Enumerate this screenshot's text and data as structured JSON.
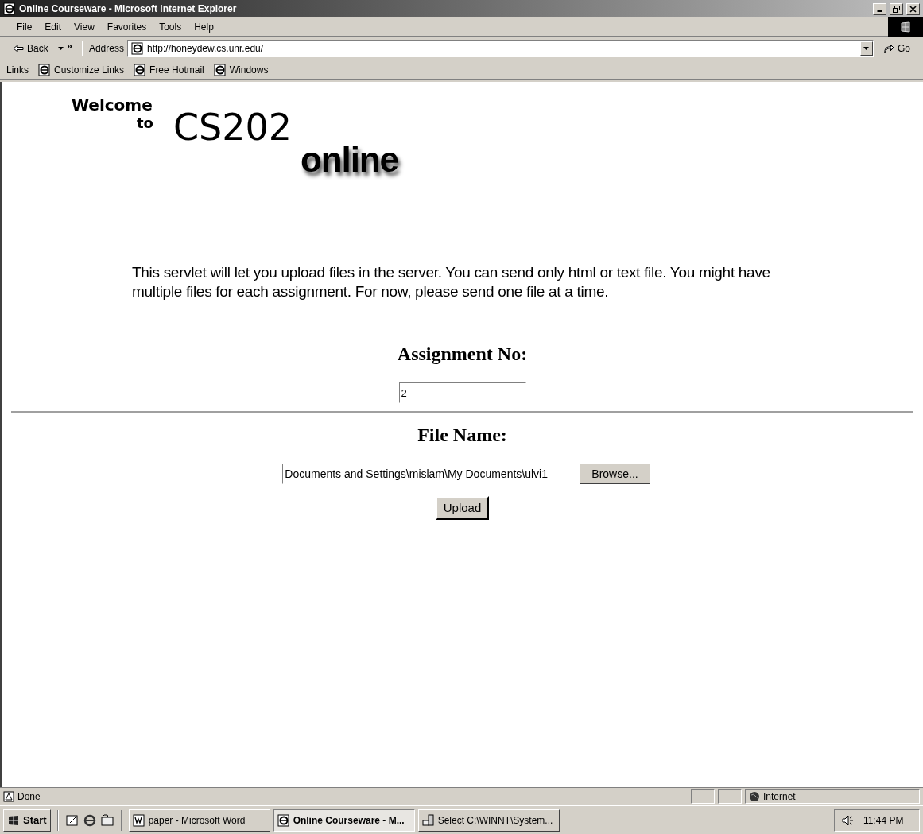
{
  "window": {
    "title": "Online Courseware - Microsoft Internet Explorer"
  },
  "menu": [
    "File",
    "Edit",
    "View",
    "Favorites",
    "Tools",
    "Help"
  ],
  "toolbar": {
    "back": "Back",
    "more": "»",
    "address_label": "Address",
    "url": "http://honeydew.cs.unr.edu/",
    "go": "Go"
  },
  "links_bar": {
    "label": "Links",
    "items": [
      "Customize Links",
      "Free Hotmail",
      "Windows"
    ]
  },
  "page": {
    "logo": {
      "welcome": "Welcome",
      "to": "to",
      "course": "CS202",
      "online": "online"
    },
    "intro": "This servlet will let you upload files in the server. You can send only html or text file. You might have multiple files for each assignment. For now, please send one file at a time.",
    "assignment_label": "Assignment No:",
    "assignment_value": "2",
    "file_label": "File Name:",
    "file_value": "Documents and Settings\\mislam\\My Documents\\ulvi1",
    "browse": "Browse...",
    "upload": "Upload"
  },
  "status_bar": {
    "text": "Done",
    "zone": "Internet"
  },
  "taskbar": {
    "start": "Start",
    "tasks": [
      {
        "label": "paper - Microsoft Word",
        "kind": "word",
        "selected": false
      },
      {
        "label": "Online Courseware - M...",
        "kind": "browser",
        "selected": true
      },
      {
        "label": "Select C:\\WINNT\\System...",
        "kind": "system",
        "selected": false
      }
    ],
    "clock": "11:44 PM"
  }
}
